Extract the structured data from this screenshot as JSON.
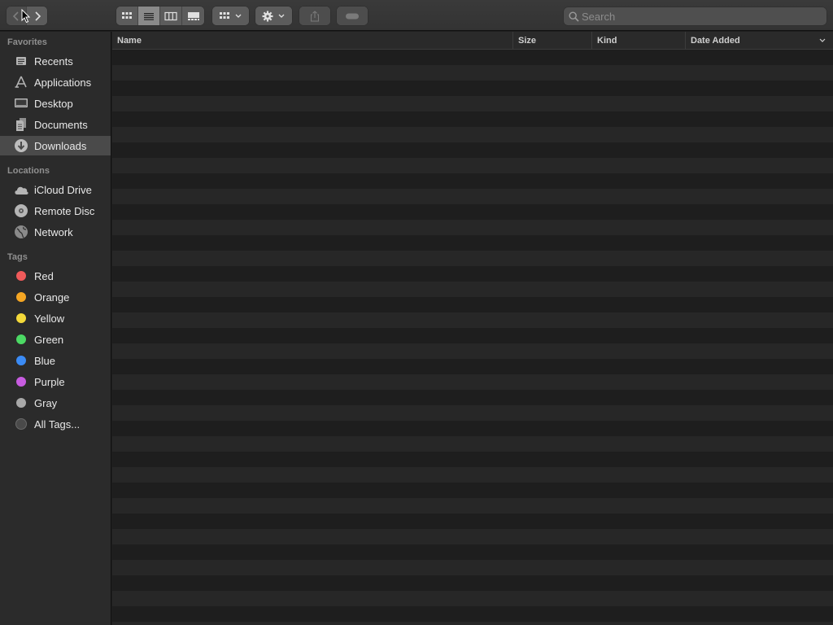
{
  "toolbar": {
    "nav": [
      {
        "name": "back-button",
        "icon": "chevron-left-icon",
        "enabled": false
      },
      {
        "name": "forward-button",
        "icon": "chevron-right-icon",
        "enabled": true
      }
    ],
    "view_modes": [
      {
        "name": "icon-view-button",
        "icon": "grid-icon",
        "active": false
      },
      {
        "name": "list-view-button",
        "icon": "list-icon",
        "active": true
      },
      {
        "name": "column-view-button",
        "icon": "columns-icon",
        "active": false
      },
      {
        "name": "gallery-view-button",
        "icon": "gallery-icon",
        "active": false
      }
    ],
    "group_button_icon": "group-grid-icon",
    "action_button_icon": "gear-icon",
    "share_button_icon": "share-icon",
    "tags_button_icon": "tag-icon",
    "search": {
      "placeholder": "Search",
      "value": ""
    }
  },
  "sidebar": {
    "sections": [
      {
        "title": "Favorites",
        "items": [
          {
            "label": "Recents",
            "icon": "clock-icon",
            "selected": false
          },
          {
            "label": "Applications",
            "icon": "applications-icon",
            "selected": false
          },
          {
            "label": "Desktop",
            "icon": "desktop-icon",
            "selected": false
          },
          {
            "label": "Documents",
            "icon": "document-icon",
            "selected": false
          },
          {
            "label": "Downloads",
            "icon": "download-icon",
            "selected": true
          }
        ]
      },
      {
        "title": "Locations",
        "items": [
          {
            "label": "iCloud Drive",
            "icon": "cloud-icon",
            "selected": false
          },
          {
            "label": "Remote Disc",
            "icon": "disc-icon",
            "selected": false
          },
          {
            "label": "Network",
            "icon": "globe-icon",
            "selected": false
          }
        ]
      },
      {
        "title": "Tags",
        "items": [
          {
            "label": "Red",
            "color": "#f05a5a"
          },
          {
            "label": "Orange",
            "color": "#f5a623"
          },
          {
            "label": "Yellow",
            "color": "#f4d93a"
          },
          {
            "label": "Green",
            "color": "#4cd964"
          },
          {
            "label": "Blue",
            "color": "#3b8bf5"
          },
          {
            "label": "Purple",
            "color": "#c75ce0"
          },
          {
            "label": "Gray",
            "color": "#a8a8a8"
          },
          {
            "label": "All Tags...",
            "color": "#5e5e5e"
          }
        ]
      }
    ]
  },
  "columns": {
    "name": "Name",
    "size": "Size",
    "kind": "Kind",
    "date_added": "Date Added"
  },
  "files": []
}
